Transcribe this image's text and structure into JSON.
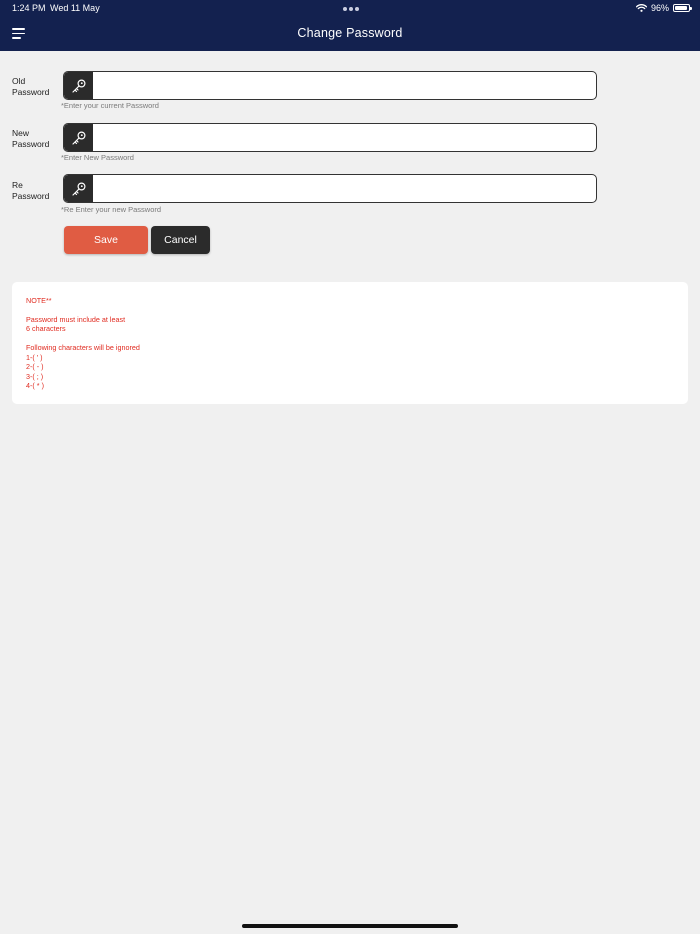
{
  "status_bar": {
    "time": "1:24 PM",
    "date": "Wed 11 May",
    "battery_text": "96%",
    "battery_level": 0.96,
    "wifi_icon": "wifi-icon"
  },
  "header": {
    "title": "Change Password",
    "menu_icon": "menu-icon",
    "background_color": "#13214f"
  },
  "form": {
    "old_password": {
      "label": "Old Password",
      "value": "",
      "placeholder": "",
      "hint": "*Enter your current Password",
      "icon": "key-icon"
    },
    "new_password": {
      "label": "New Password",
      "value": "",
      "placeholder": "",
      "hint": "*Enter New Password",
      "icon": "key-icon"
    },
    "re_password": {
      "label": "Re Password",
      "value": "",
      "placeholder": "",
      "hint": "*Re Enter your new Password",
      "icon": "key-icon"
    }
  },
  "actions": {
    "save_label": "Save",
    "cancel_label": "Cancel",
    "save_color": "#e05c43",
    "cancel_color": "#2b2b2b"
  },
  "note": {
    "heading": "NOTE**",
    "length_rule_line1": "Password must include at least",
    "length_rule_line2": "6 characters",
    "ignored_heading": "Following characters will be ignored",
    "ignored_chars": [
      "1-( ' )",
      "2-( - )",
      "3-( ; )",
      "4-( * )"
    ],
    "text_color": "#e02b20"
  }
}
